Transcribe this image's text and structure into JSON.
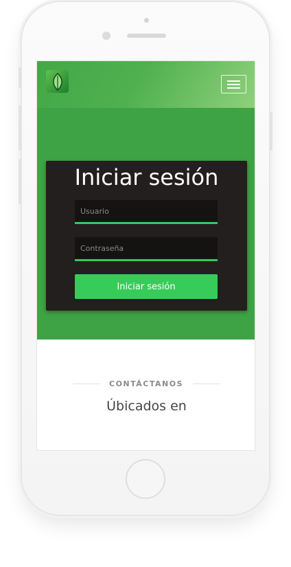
{
  "header": {
    "logo_icon": "leaf-icon",
    "menu_icon": "hamburger-icon"
  },
  "login": {
    "title": "Iniciar sesión",
    "username_placeholder": "Usuario",
    "password_placeholder": "Contraseña",
    "submit_label": "Iniciar sesión"
  },
  "contact": {
    "kicker": "CONTÁCTANOS",
    "heading": "Úbicados en"
  },
  "colors": {
    "hero_green": "#3ea344",
    "card_dark": "#231f1e",
    "button_green": "#37cc5a"
  }
}
